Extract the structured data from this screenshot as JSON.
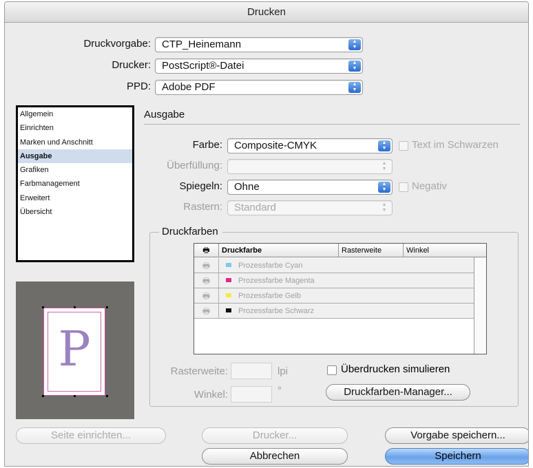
{
  "window": {
    "title": "Drucken"
  },
  "top": {
    "preset_label": "Druckvorgabe:",
    "preset_value": "CTP_Heinemann",
    "printer_label": "Drucker:",
    "printer_value": "PostScript®-Datei",
    "ppd_label": "PPD:",
    "ppd_value": "Adobe PDF"
  },
  "sidebar": {
    "items": [
      {
        "label": "Allgemein"
      },
      {
        "label": "Einrichten"
      },
      {
        "label": "Marken und Anschnitt"
      },
      {
        "label": "Ausgabe"
      },
      {
        "label": "Grafiken"
      },
      {
        "label": "Farbmanagement"
      },
      {
        "label": "Erweitert"
      },
      {
        "label": "Übersicht"
      }
    ],
    "selected": "Ausgabe"
  },
  "preview": {
    "letter": "P"
  },
  "output": {
    "heading": "Ausgabe",
    "color_label": "Farbe:",
    "color_value": "Composite-CMYK",
    "text_black_label": "Text im Schwarzen",
    "trapping_label": "Überfüllung:",
    "trapping_value": "",
    "mirror_label": "Spiegeln:",
    "mirror_value": "Ohne",
    "negative_label": "Negativ",
    "screening_label": "Rastern:",
    "screening_value": "Standard"
  },
  "inks": {
    "heading": "Druckfarben",
    "columns": {
      "ink": "Druckfarbe",
      "frequency": "Rasterweite",
      "angle": "Winkel"
    },
    "rows": [
      {
        "name": "Prozessfarbe Cyan",
        "color": "#7fc8ee"
      },
      {
        "name": "Prozessfarbe Magenta",
        "color": "#e0298c"
      },
      {
        "name": "Prozessfarbe Gelb",
        "color": "#f4ec3c"
      },
      {
        "name": "Prozessfarbe Schwarz",
        "color": "#111111"
      }
    ],
    "frequency_label": "Rasterweite:",
    "frequency_unit": "lpi",
    "angle_label": "Winkel:",
    "angle_unit": "°",
    "simulate_overprint_label": "Überdrucken simulieren",
    "ink_manager_label": "Druckfarben-Manager..."
  },
  "buttons": {
    "page_setup": "Seite einrichten...",
    "printer": "Drucker...",
    "save_preset": "Vorgabe speichern...",
    "cancel": "Abbrechen",
    "save": "Speichern"
  }
}
